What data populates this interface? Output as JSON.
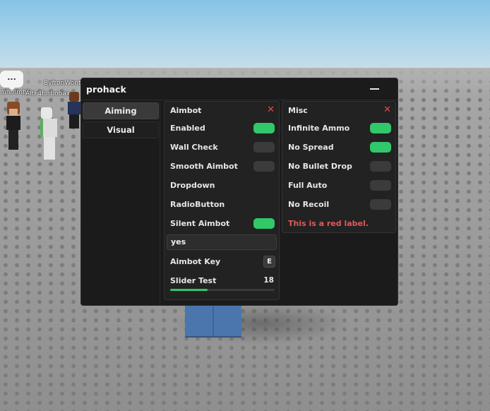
{
  "scene": {
    "chat_bubble": "...",
    "player_names": [
      "mhmmh5",
      "ByfronWonts",
      "AltF4forbobax"
    ],
    "colors": {
      "sky": "#a9d3ea",
      "ground": "#9b9b9b",
      "block": "#4a76ad"
    }
  },
  "window": {
    "title": "prohack",
    "minimize_icon": "minimize-icon",
    "tabs": [
      {
        "label": "Aiming",
        "active": true
      },
      {
        "label": "Visual",
        "active": false
      }
    ]
  },
  "aimbot": {
    "title": "Aimbot",
    "close_icon": "close-icon",
    "enabled": {
      "label": "Enabled",
      "on": true
    },
    "wall_check": {
      "label": "Wall Check",
      "on": false
    },
    "smooth_aimbot": {
      "label": "Smooth Aimbot",
      "on": false
    },
    "dropdown": {
      "label": "Dropdown"
    },
    "radio_button": {
      "label": "RadioButton"
    },
    "silent_aimbot": {
      "label": "Silent Aimbot",
      "on": true
    },
    "text_field": {
      "value": "yes"
    },
    "aimbot_key": {
      "label": "Aimbot Key",
      "key": "E"
    },
    "slider": {
      "label": "Slider Test",
      "value": "18",
      "fill_fraction": 0.36
    }
  },
  "misc": {
    "title": "Misc",
    "close_icon": "close-icon",
    "infinite_ammo": {
      "label": "Infinite Ammo",
      "on": true
    },
    "no_spread": {
      "label": "No Spread",
      "on": true
    },
    "no_bullet_drop": {
      "label": "No Bullet Drop",
      "on": false
    },
    "full_auto": {
      "label": "Full Auto",
      "on": false
    },
    "no_recoil": {
      "label": "No Recoil",
      "on": false
    },
    "red_label": "This is a red label.",
    "accent_color": "#31c86a",
    "danger_color": "#e05a5a"
  }
}
